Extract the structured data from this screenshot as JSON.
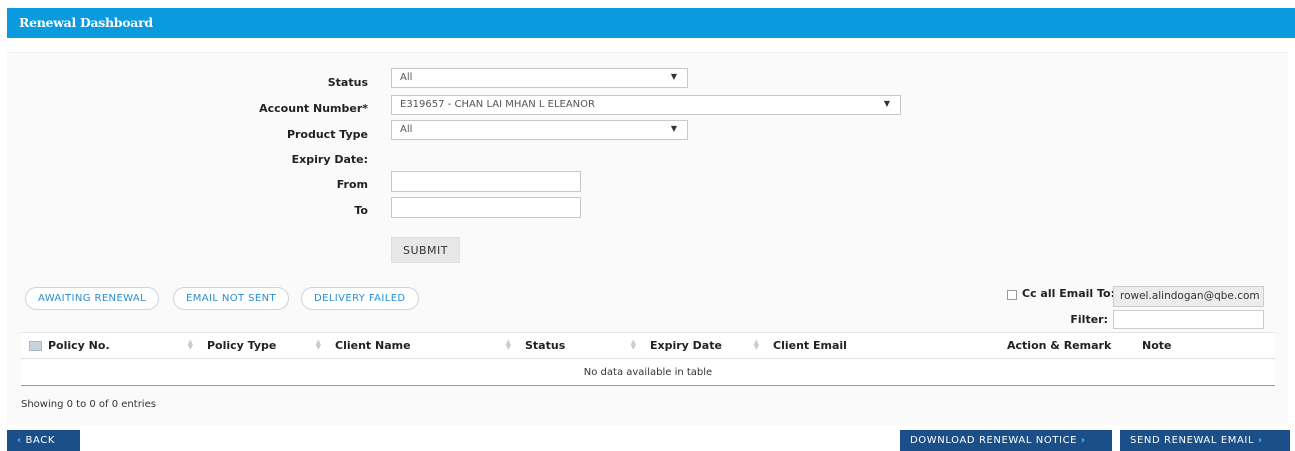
{
  "header": {
    "title": "Renewal Dashboard"
  },
  "form": {
    "status_label": "Status",
    "status_value": "All",
    "account_label": "Account Number*",
    "account_value": "E319657 - CHAN LAI MHAN L ELEANOR",
    "product_label": "Product Type",
    "product_value": "All",
    "expiry_label": "Expiry Date:",
    "from_label": "From",
    "to_label": "To",
    "submit_label": "SUBMIT"
  },
  "filters": {
    "awaiting": "AWAITING RENEWAL",
    "email_not_sent": "EMAIL NOT SENT",
    "delivery_failed": "DELIVERY FAILED"
  },
  "cc": {
    "label": "Cc all Email To:",
    "value": "rowel.alindogan@qbe.com",
    "filter_label": "Filter:"
  },
  "table": {
    "columns": [
      "Policy No.",
      "Policy Type",
      "Client Name",
      "Status",
      "Expiry Date",
      "Client Email",
      "Action & Remark",
      "Note"
    ],
    "empty_message": "No data available in table",
    "info": "Showing 0 to 0 of 0 entries"
  },
  "footer": {
    "back_label": "BACK",
    "download_label": "DOWNLOAD RENEWAL NOTICE",
    "send_label": "SEND RENEWAL EMAIL"
  },
  "icons": {
    "dropdown": "triangle-down-icon",
    "chevron_left": "chevron-left-icon",
    "chevron_right": "chevron-right-icon"
  },
  "colors": {
    "header_bg": "#0a9ade",
    "button_bg": "#1a4f8a",
    "pill_text": "#2a8fd0"
  }
}
